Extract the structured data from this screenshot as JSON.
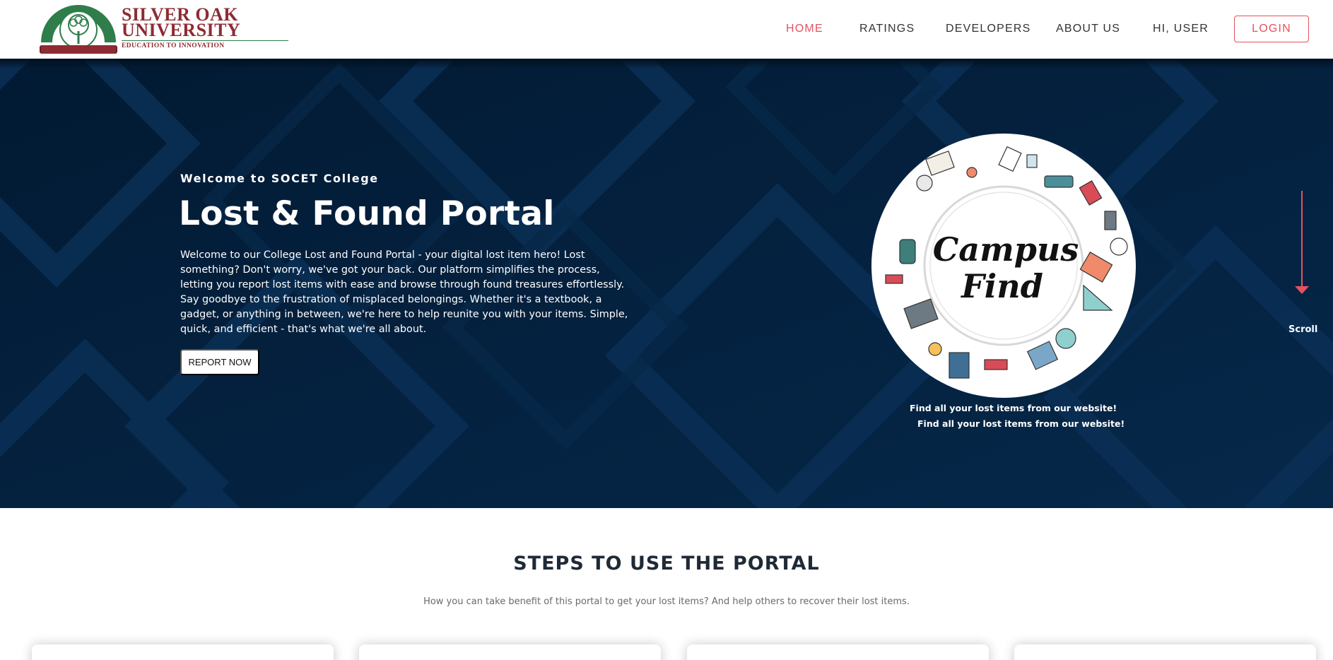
{
  "brand": {
    "name_line1": "SILVER OAK",
    "name_line2": "UNIVERSITY",
    "tagline": "EDUCATION TO INNOVATION",
    "emblem_ring_text": "SILVER OAK UNIVERSITY",
    "emblem_banner_text": "ज्ञान परम भूषणम्",
    "colors": {
      "maroon": "#8e2b33",
      "green": "#2f7d4b"
    }
  },
  "nav": {
    "items": [
      {
        "label": "HOME",
        "active": true
      },
      {
        "label": "RATINGS",
        "active": false
      },
      {
        "label": "DEVELOPERS",
        "active": false
      },
      {
        "label": "ABOUT US",
        "active": false
      },
      {
        "label": "HI, USER",
        "active": false
      }
    ],
    "login_label": "LOGIN",
    "accent": "#e8515d"
  },
  "hero": {
    "kicker": "Welcome to SOCET College",
    "title": "Lost & Found Portal",
    "description": "Welcome to our College Lost and Found Portal - your digital lost item hero! Lost something? Don't worry, we've got your back. Our platform simplifies the process, letting you report lost items with ease and browse through found treasures effortlessly. Say goodbye to the frustration of misplaced belongings. Whether it's a textbook, a gadget, or anything in between, we're here to help reunite you with your items. Simple, quick, and efficient - that's what we're all about.",
    "cta_label": "REPORT NOW",
    "image_text_line1": "Campus",
    "image_text_line2": "Find",
    "caption_1": "Find all your lost items from our website!",
    "caption_2": "Find all your lost items from our website!",
    "scroll_label": "Scroll",
    "background": "#04213d"
  },
  "steps": {
    "title": "STEPS TO USE THE PORTAL",
    "subtitle": "How you can take benefit of this portal to get your lost items? And help others to recover their lost items."
  }
}
